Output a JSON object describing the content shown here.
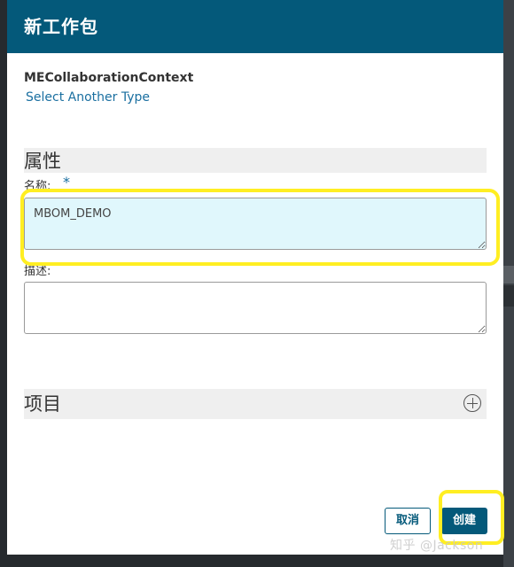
{
  "dialog": {
    "title": "新工作包",
    "type_name": "MECollaborationContext",
    "select_type_link": "Select Another Type"
  },
  "properties": {
    "section_title": "属性",
    "name_label": "名称:",
    "required_marker": "*",
    "name_value": "MBOM_DEMO",
    "description_label": "描述:",
    "description_value": ""
  },
  "items": {
    "section_title": "项目",
    "add_icon": "plus-circle-icon"
  },
  "buttons": {
    "cancel_label": "取消",
    "create_label": "创建"
  },
  "watermark": {
    "text": "知乎 @Jackson"
  },
  "colors": {
    "header": "#04597a",
    "link": "#1a6fa0",
    "highlight": "#ffee22",
    "name_field_bg": "#e0f7fc"
  }
}
